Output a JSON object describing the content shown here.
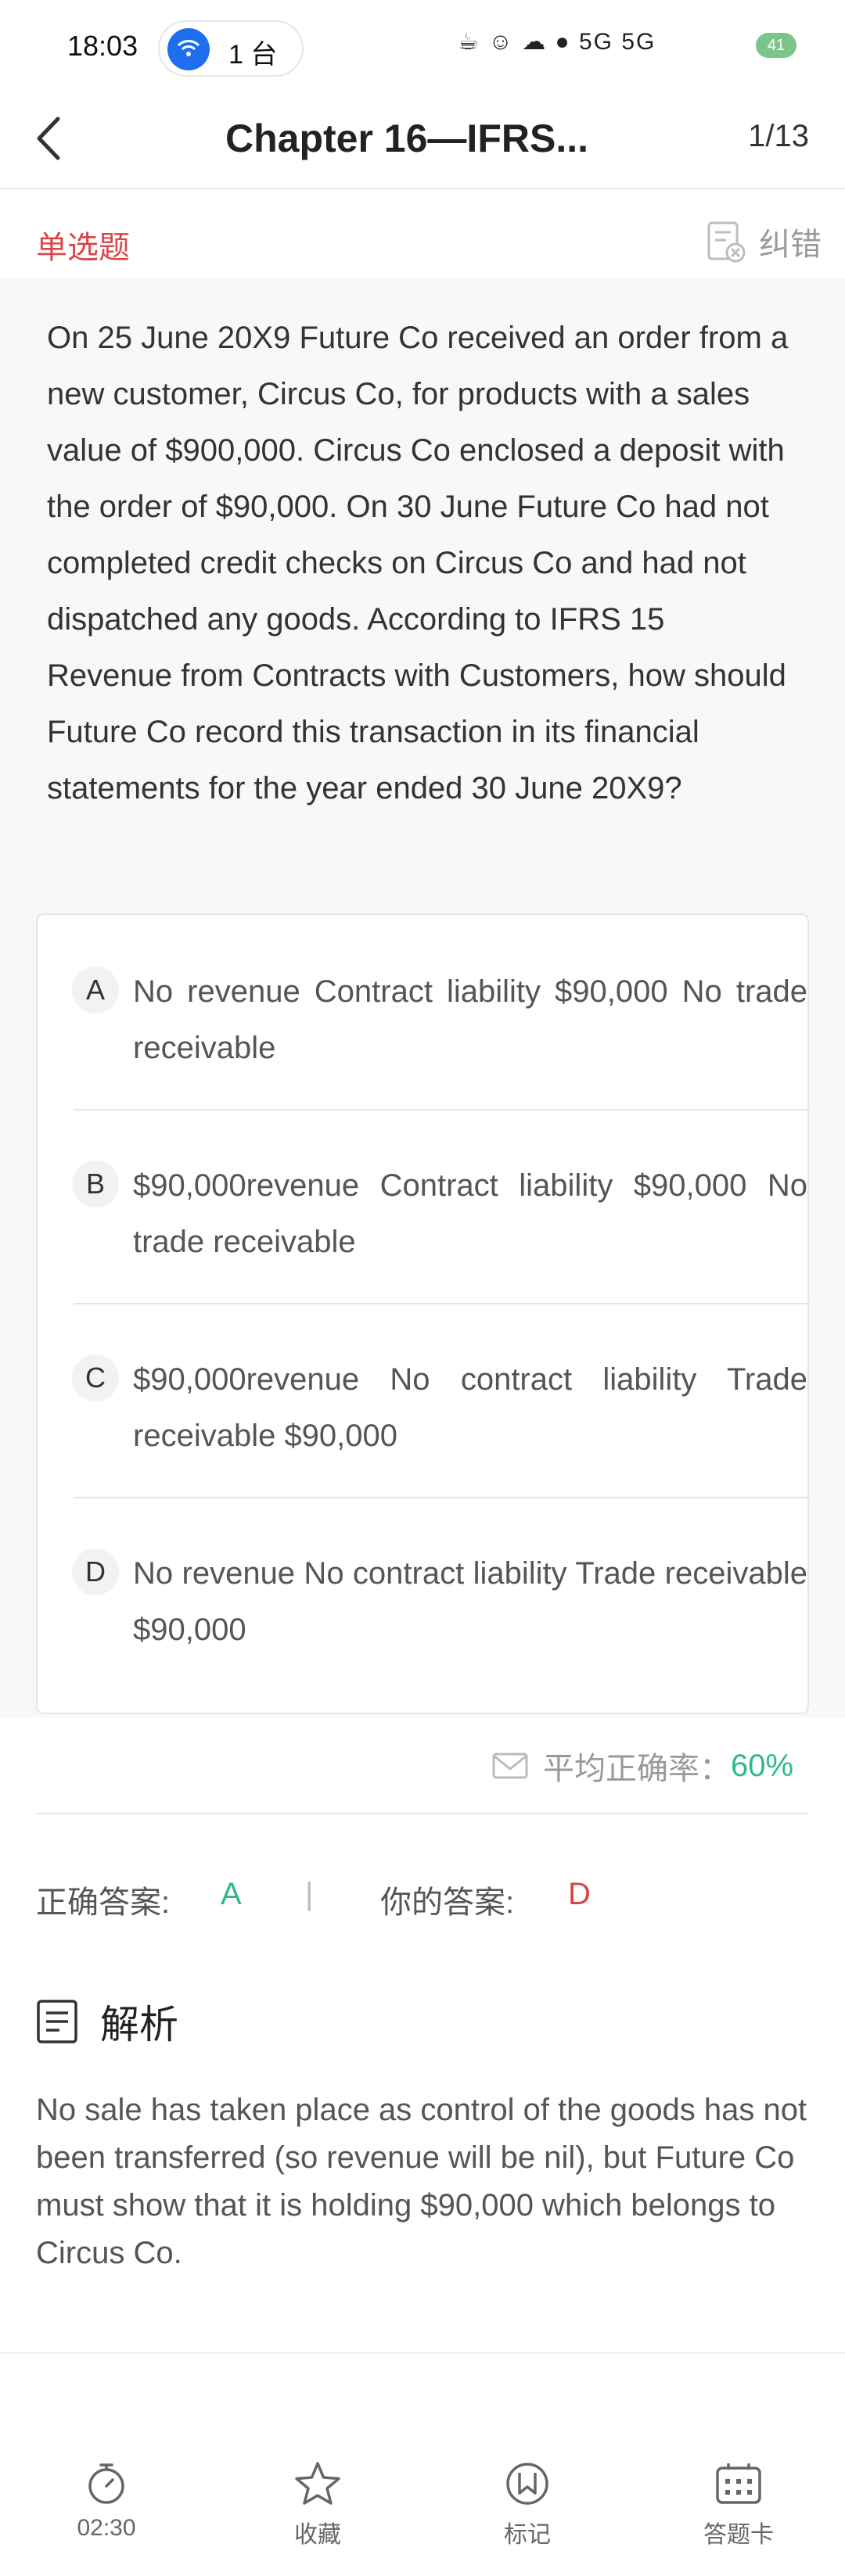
{
  "status_bar": {
    "time": "18:03",
    "hotspot_text": "1 台",
    "battery": "41",
    "signal_text": "5G 5G"
  },
  "nav": {
    "title": "Chapter 16—IFRS...",
    "progress": "1/13"
  },
  "question": {
    "type_label": "单选题",
    "report_label": "纠错",
    "text": "On 25 June 20X9 Future Co received an order from a new customer, Circus Co, for products with a sales value of $900,000. Circus Co enclosed a deposit with the order of $90,000. On 30 June Future Co had not completed credit checks on Circus Co and had not dispatched any goods. According to IFRS 15 Revenue from Contracts with Customers, how should Future Co record this transaction in its financial statements for the year ended 30 June 20X9?",
    "options": [
      {
        "letter": "A",
        "text": "No revenue Contract liability $90,000 No trade receivable"
      },
      {
        "letter": "B",
        "text": "$90,000revenue Contract liability $90,000 No trade receivable"
      },
      {
        "letter": "C",
        "text": "$90,000revenue No contract liability Trade receivable $90,000"
      },
      {
        "letter": "D",
        "text": "No revenue No contract liability Trade receivable $90,000"
      }
    ]
  },
  "stats": {
    "accuracy_label": "平均正确率：",
    "accuracy_value": "60%"
  },
  "answers": {
    "correct_label": "正确答案:",
    "correct_value": "A",
    "separator": "|",
    "your_label": "你的答案:",
    "your_value": "D"
  },
  "analysis": {
    "title": "解析",
    "text": "No sale has taken place as control of the goods has not been transferred (so revenue will be nil), but Future Co must show that it is holding $90,000 which belongs to Circus Co."
  },
  "bottom_bar": {
    "timer": "02:30",
    "favorite": "收藏",
    "mark": "标记",
    "answer_card": "答题卡"
  },
  "colors": {
    "accent_red": "#d9464a",
    "accent_green": "#2fb98a",
    "hotspot_blue": "#1e6ff0"
  }
}
